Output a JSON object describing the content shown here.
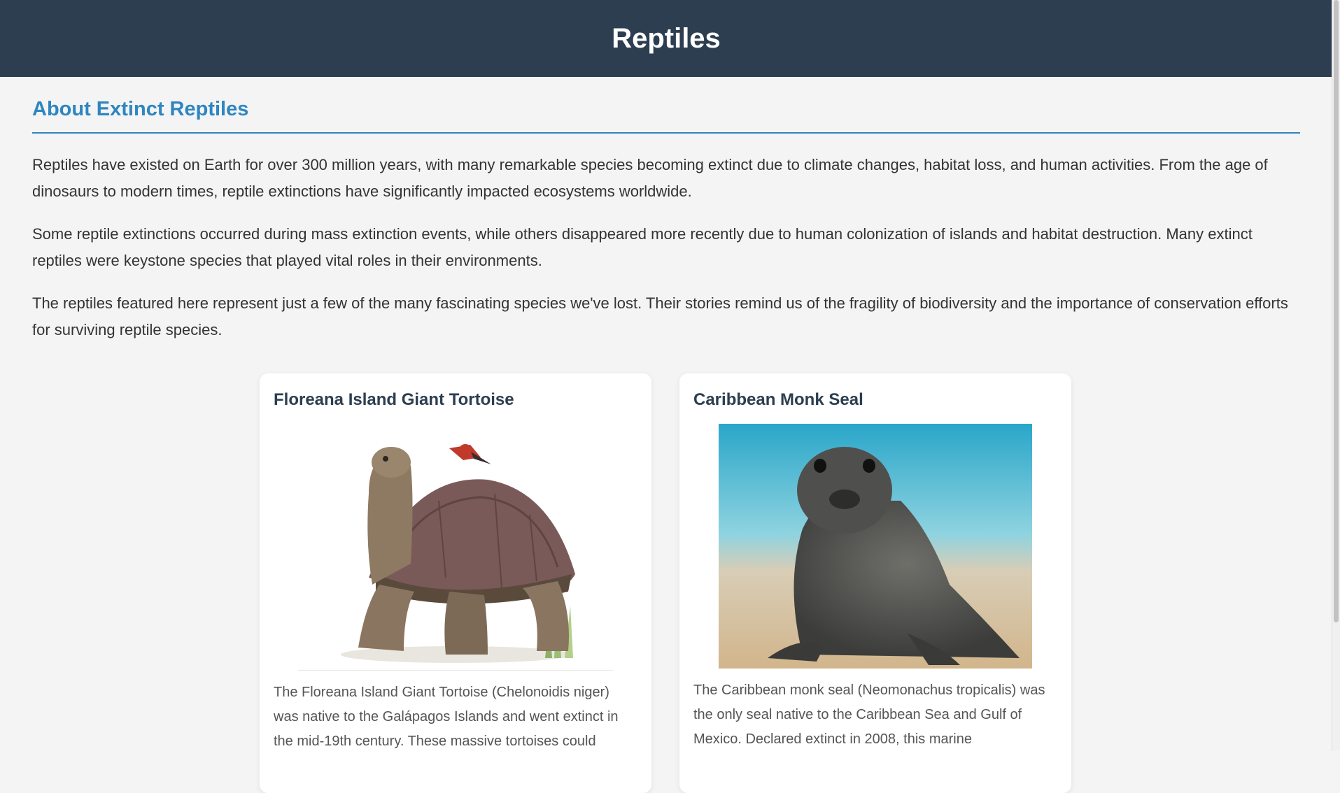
{
  "header": {
    "title": "Reptiles"
  },
  "about": {
    "title": "About Extinct Reptiles",
    "paragraphs": [
      "Reptiles have existed on Earth for over 300 million years, with many remarkable species becoming extinct due to climate changes, habitat loss, and human activities. From the age of dinosaurs to modern times, reptile extinctions have significantly impacted ecosystems worldwide.",
      "Some reptile extinctions occurred during mass extinction events, while others disappeared more recently due to human colonization of islands and habitat destruction. Many extinct reptiles were keystone species that played vital roles in their environments.",
      "The reptiles featured here represent just a few of the many fascinating species we've lost. Their stories remind us of the fragility of biodiversity and the importance of conservation efforts for surviving reptile species."
    ]
  },
  "cards": [
    {
      "title": "Floreana Island Giant Tortoise",
      "description": "The Floreana Island Giant Tortoise (Chelonoidis niger) was native to the Galápagos Islands and went extinct in the mid-19th century. These massive tortoises could"
    },
    {
      "title": "Caribbean Monk Seal",
      "description": "The Caribbean monk seal (Neomonachus tropicalis) was the only seal native to the Caribbean Sea and Gulf of Mexico. Declared extinct in 2008, this marine"
    }
  ],
  "colors": {
    "header_bg": "#2c3e50",
    "accent": "#2e86c1",
    "page_bg": "#f4f4f4"
  }
}
